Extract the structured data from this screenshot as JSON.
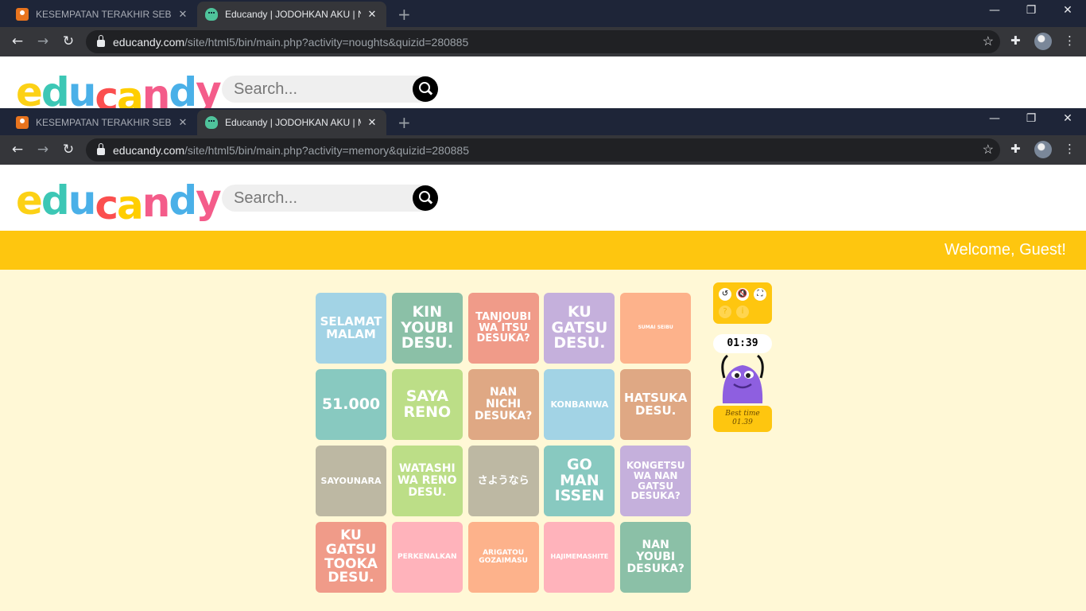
{
  "browser_back": {
    "tabs": [
      {
        "title": "KESEMPATAN TERAKHIR SEBELUM",
        "favicon": "user-badge-icon"
      },
      {
        "title": "Educandy | JODOHKAN AKU | No",
        "favicon": "educandy-monster-icon"
      }
    ],
    "url_host": "educandy.com",
    "url_path": "/site/html5/bin/main.php?activity=noughts&quizid=280885"
  },
  "browser_front": {
    "tabs": [
      {
        "title": "KESEMPATAN TERAKHIR SEBELUM",
        "favicon": "user-badge-icon"
      },
      {
        "title": "Educandy | JODOHKAN AKU | Me",
        "favicon": "educandy-monster-icon"
      }
    ],
    "url_host": "educandy.com",
    "url_path": "/site/html5/bin/main.php?activity=memory&quizid=280885"
  },
  "site": {
    "logo_letters": [
      "e",
      "d",
      "u",
      "c",
      "a",
      "n",
      "d",
      "y"
    ],
    "logo_colors": [
      "#fcd116",
      "#3cc7b5",
      "#4ab0e8",
      "#fb4f4f",
      "#ffce00",
      "#f45c8a",
      "#4ab0e8",
      "#f45c8a"
    ],
    "search_placeholder": "Search...",
    "welcome": "Welcome, Guest!"
  },
  "cards": [
    {
      "text": "SELAMAT MALAM",
      "color": "#a2d3e5",
      "size": 15
    },
    {
      "text": "KIN YOUBI DESU.",
      "color": "#8bc0a7",
      "size": 19
    },
    {
      "text": "TANJOUBI WA ITSU DESUKA?",
      "color": "#f09b89",
      "size": 13
    },
    {
      "text": "KU GATSU DESU.",
      "color": "#c5b0dc",
      "size": 19
    },
    {
      "text": "SUMAI SEIBU",
      "color": "#fdb28b",
      "size": 6
    },
    {
      "text": "51.000",
      "color": "#88c9c0",
      "size": 19
    },
    {
      "text": "SAYA RENO",
      "color": "#bcde87",
      "size": 19
    },
    {
      "text": "NAN NICHI DESUKA?",
      "color": "#dfa884",
      "size": 14
    },
    {
      "text": "KONBANWA",
      "color": "#a2d3e5",
      "size": 11
    },
    {
      "text": "HATSUKA DESU.",
      "color": "#dfa884",
      "size": 15
    },
    {
      "text": "SAYOUNARA",
      "color": "#bdb8a3",
      "size": 11
    },
    {
      "text": "WATASHI WA RENO DESU.",
      "color": "#bcde87",
      "size": 14
    },
    {
      "text": "さようなら",
      "color": "#bdb8a3",
      "size": 13
    },
    {
      "text": "GO MAN ISSEN",
      "color": "#88c9c0",
      "size": 19
    },
    {
      "text": "KONGETSU WA NAN GATSU DESUKA?",
      "color": "#c5b0dc",
      "size": 12
    },
    {
      "text": "KU GATSU TOOKA DESU.",
      "color": "#f09b89",
      "size": 17
    },
    {
      "text": "PERKENALKAN",
      "color": "#ffb3bb",
      "size": 9
    },
    {
      "text": "ARIGATOU GOZAIMASU",
      "color": "#fdb28b",
      "size": 9
    },
    {
      "text": "HAJIMEMASHITE",
      "color": "#ffb3bb",
      "size": 8
    },
    {
      "text": "NAN YOUBI DESUKA?",
      "color": "#8bc0a7",
      "size": 14
    }
  ],
  "game": {
    "controls": {
      "restart": "↺",
      "mute": "🔇",
      "fullscreen": "⛶",
      "help": "?",
      "info": "i"
    },
    "timer": "01:39",
    "best_time_label": "Best time",
    "best_time_value": "01.39"
  }
}
